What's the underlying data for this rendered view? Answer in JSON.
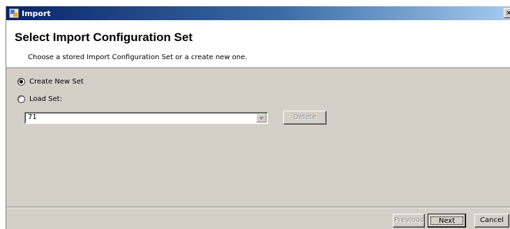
{
  "window": {
    "title": "Import",
    "app_icon": "import-wizard-icon",
    "close_glyph": "✕"
  },
  "header": {
    "title": "Select Import Configuration Set",
    "subtitle": "Choose a stored Import Configuration Set or a create new one."
  },
  "options": {
    "create_new_label": "Create New Set",
    "create_new_checked": true,
    "load_set_label": "Load Set:",
    "load_set_checked": false
  },
  "set_selector": {
    "value": "71"
  },
  "buttons": {
    "delete": "Delete",
    "previous": "Previous",
    "next": "Next",
    "cancel": "Cancel"
  },
  "colors": {
    "dialog_bg": "#d4d0c8",
    "title_gradient_start": "#0a246a",
    "title_gradient_end": "#a6caf0"
  }
}
